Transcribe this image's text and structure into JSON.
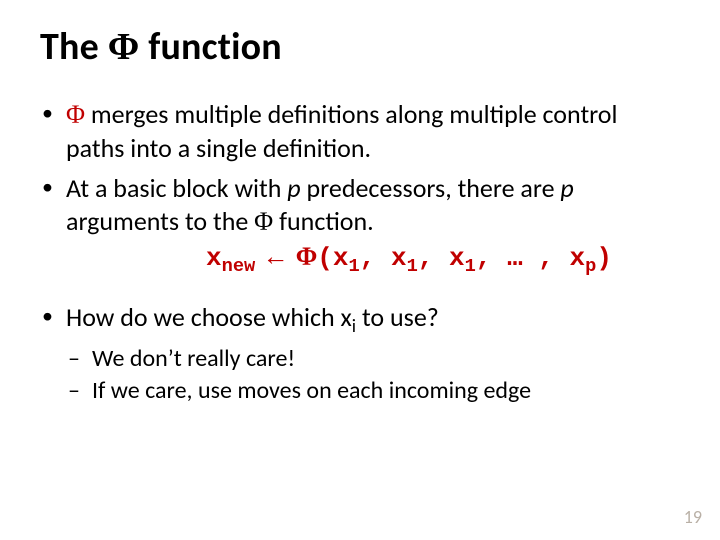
{
  "title": {
    "pre": "The ",
    "phi": "Φ",
    "post": " function"
  },
  "bullets": {
    "b1": {
      "phi": "Φ",
      "rest": " merges multiple definitions along multiple control paths into a single definition."
    },
    "b2": {
      "pre": "At a basic block with ",
      "p1": "p",
      "mid": " predecessors, there are ",
      "p2": "p",
      "mid2": " arguments to the ",
      "phi": "Φ",
      "post": " function."
    },
    "b3": {
      "pre": "How do we choose which x",
      "sub": "i",
      "post": " to use?"
    }
  },
  "formula": {
    "xnew_x": "x",
    "xnew_sub": "new",
    "arrow": " ← ",
    "phi": "Φ",
    "open": "(",
    "x1a_x": "x",
    "x1a_sub": "1",
    "sep1": ", ",
    "x1b_x": "x",
    "x1b_sub": "1",
    "sep2": ", ",
    "x1c_x": "x",
    "x1c_sub": "1",
    "sep3": ", … , ",
    "xp_x": "x",
    "xp_sub": "p",
    "close": ")"
  },
  "sub": {
    "s1": "We don’t really care!",
    "s2": "If we care, use moves on each incoming edge"
  },
  "page": "19"
}
